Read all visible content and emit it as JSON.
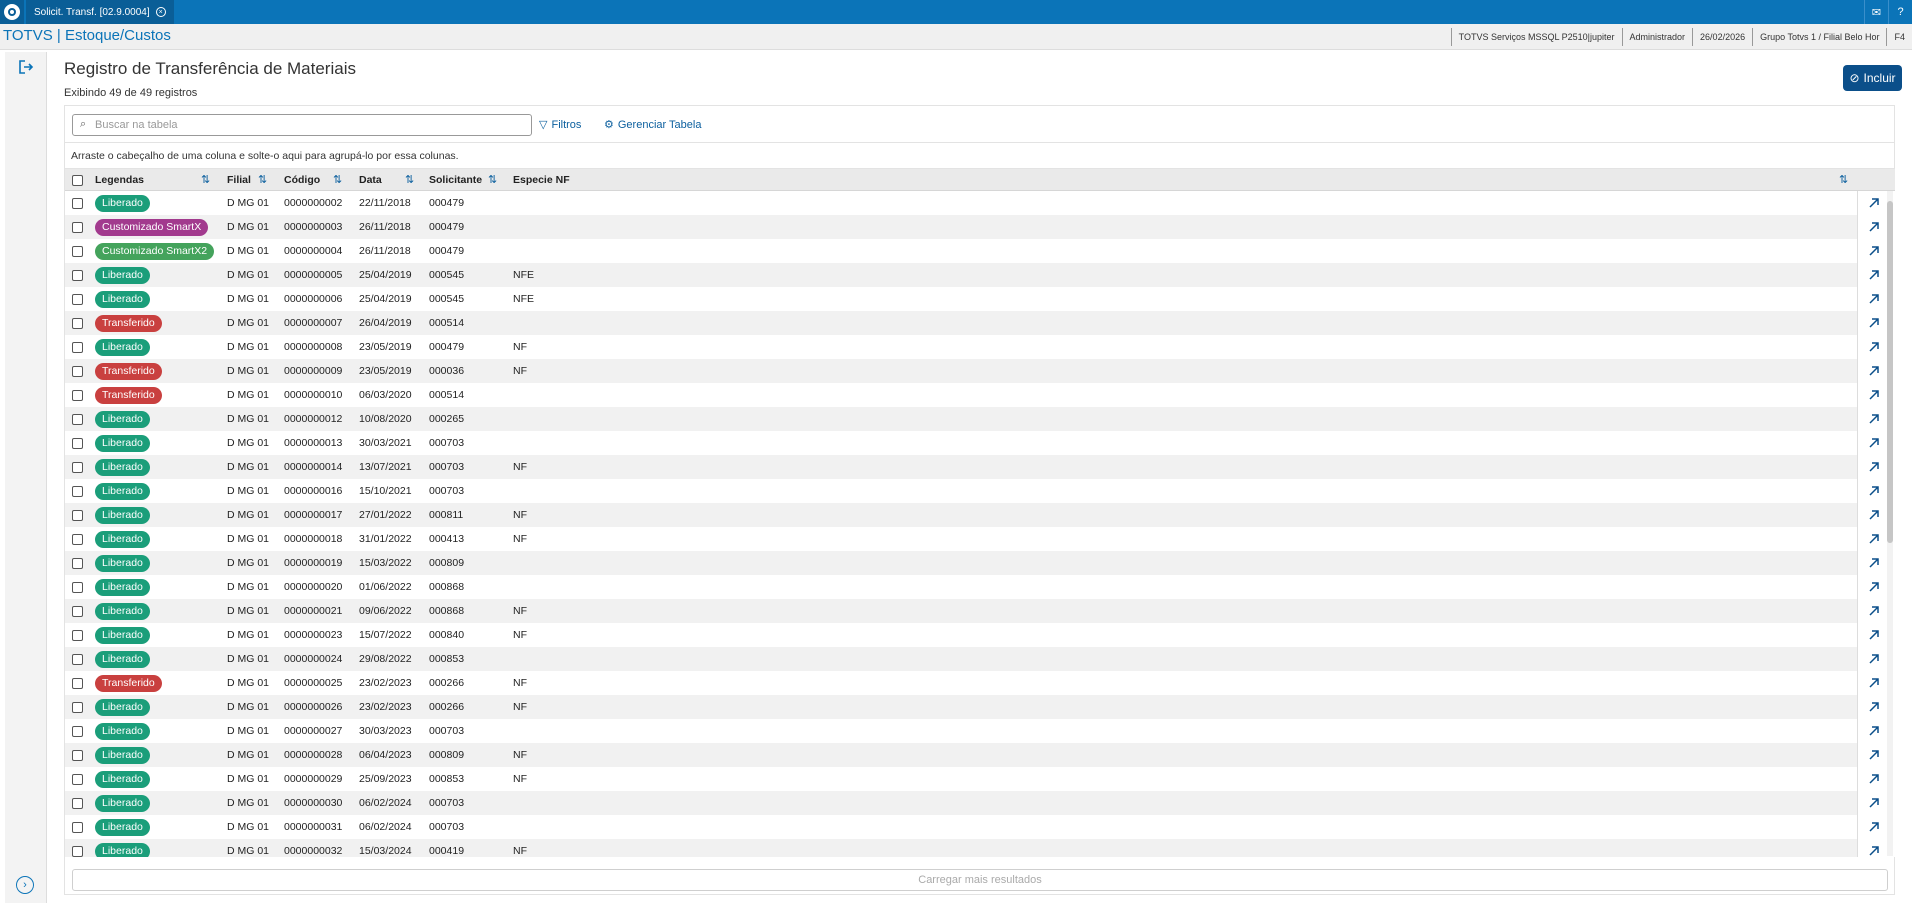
{
  "window": {
    "tab_title": "Solicit. Transf. [02.9.0004]",
    "close_glyph": "×",
    "right_icons": [
      "mail-icon",
      "help-icon"
    ]
  },
  "infobar": {
    "brand": "TOTVS | Estoque/Custos",
    "items": [
      "TOTVS Serviços MSSQL P2510|jupiter",
      "Administrador",
      "26/02/2026",
      "Grupo Totvs 1 / Filial Belo Hor",
      "F4"
    ]
  },
  "page": {
    "title": "Registro de Transferência de Materiais",
    "subtitle": "Exibindo 49 de 49 registros",
    "include_label": "Incluir"
  },
  "toolbar": {
    "search_placeholder": "Buscar na tabela",
    "filters_label": "Filtros",
    "manage_label": "Gerenciar Tabela"
  },
  "group_hint": "Arraste o cabeçalho de uma coluna e solte-o aqui para agrupá-lo por essa colunas.",
  "columns": {
    "legendas": "Legendas",
    "filial": "Filial",
    "codigo": "Código",
    "data": "Data",
    "solicitante": "Solicitante",
    "especie": "Especie NF"
  },
  "legend_colors": {
    "Liberado": "#1b9e7a",
    "Transferido": "#c9403f",
    "Customizado SmartX": "#a23a8e",
    "Customizado SmartX2": "#44a35c"
  },
  "rows": [
    {
      "legenda": "Liberado",
      "filial": "D MG 01",
      "codigo": "0000000002",
      "data": "22/11/2018",
      "solicitante": "000479",
      "especie": ""
    },
    {
      "legenda": "Customizado SmartX",
      "filial": "D MG 01",
      "codigo": "0000000003",
      "data": "26/11/2018",
      "solicitante": "000479",
      "especie": ""
    },
    {
      "legenda": "Customizado SmartX2",
      "filial": "D MG 01",
      "codigo": "0000000004",
      "data": "26/11/2018",
      "solicitante": "000479",
      "especie": ""
    },
    {
      "legenda": "Liberado",
      "filial": "D MG 01",
      "codigo": "0000000005",
      "data": "25/04/2019",
      "solicitante": "000545",
      "especie": "NFE"
    },
    {
      "legenda": "Liberado",
      "filial": "D MG 01",
      "codigo": "0000000006",
      "data": "25/04/2019",
      "solicitante": "000545",
      "especie": "NFE"
    },
    {
      "legenda": "Transferido",
      "filial": "D MG 01",
      "codigo": "0000000007",
      "data": "26/04/2019",
      "solicitante": "000514",
      "especie": ""
    },
    {
      "legenda": "Liberado",
      "filial": "D MG 01",
      "codigo": "0000000008",
      "data": "23/05/2019",
      "solicitante": "000479",
      "especie": "NF"
    },
    {
      "legenda": "Transferido",
      "filial": "D MG 01",
      "codigo": "0000000009",
      "data": "23/05/2019",
      "solicitante": "000036",
      "especie": "NF"
    },
    {
      "legenda": "Transferido",
      "filial": "D MG 01",
      "codigo": "0000000010",
      "data": "06/03/2020",
      "solicitante": "000514",
      "especie": ""
    },
    {
      "legenda": "Liberado",
      "filial": "D MG 01",
      "codigo": "0000000012",
      "data": "10/08/2020",
      "solicitante": "000265",
      "especie": ""
    },
    {
      "legenda": "Liberado",
      "filial": "D MG 01",
      "codigo": "0000000013",
      "data": "30/03/2021",
      "solicitante": "000703",
      "especie": ""
    },
    {
      "legenda": "Liberado",
      "filial": "D MG 01",
      "codigo": "0000000014",
      "data": "13/07/2021",
      "solicitante": "000703",
      "especie": "NF"
    },
    {
      "legenda": "Liberado",
      "filial": "D MG 01",
      "codigo": "0000000016",
      "data": "15/10/2021",
      "solicitante": "000703",
      "especie": ""
    },
    {
      "legenda": "Liberado",
      "filial": "D MG 01",
      "codigo": "0000000017",
      "data": "27/01/2022",
      "solicitante": "000811",
      "especie": "NF"
    },
    {
      "legenda": "Liberado",
      "filial": "D MG 01",
      "codigo": "0000000018",
      "data": "31/01/2022",
      "solicitante": "000413",
      "especie": "NF"
    },
    {
      "legenda": "Liberado",
      "filial": "D MG 01",
      "codigo": "0000000019",
      "data": "15/03/2022",
      "solicitante": "000809",
      "especie": ""
    },
    {
      "legenda": "Liberado",
      "filial": "D MG 01",
      "codigo": "0000000020",
      "data": "01/06/2022",
      "solicitante": "000868",
      "especie": ""
    },
    {
      "legenda": "Liberado",
      "filial": "D MG 01",
      "codigo": "0000000021",
      "data": "09/06/2022",
      "solicitante": "000868",
      "especie": "NF"
    },
    {
      "legenda": "Liberado",
      "filial": "D MG 01",
      "codigo": "0000000023",
      "data": "15/07/2022",
      "solicitante": "000840",
      "especie": "NF"
    },
    {
      "legenda": "Liberado",
      "filial": "D MG 01",
      "codigo": "0000000024",
      "data": "29/08/2022",
      "solicitante": "000853",
      "especie": ""
    },
    {
      "legenda": "Transferido",
      "filial": "D MG 01",
      "codigo": "0000000025",
      "data": "23/02/2023",
      "solicitante": "000266",
      "especie": "NF"
    },
    {
      "legenda": "Liberado",
      "filial": "D MG 01",
      "codigo": "0000000026",
      "data": "23/02/2023",
      "solicitante": "000266",
      "especie": "NF"
    },
    {
      "legenda": "Liberado",
      "filial": "D MG 01",
      "codigo": "0000000027",
      "data": "30/03/2023",
      "solicitante": "000703",
      "especie": ""
    },
    {
      "legenda": "Liberado",
      "filial": "D MG 01",
      "codigo": "0000000028",
      "data": "06/04/2023",
      "solicitante": "000809",
      "especie": "NF"
    },
    {
      "legenda": "Liberado",
      "filial": "D MG 01",
      "codigo": "0000000029",
      "data": "25/09/2023",
      "solicitante": "000853",
      "especie": "NF"
    },
    {
      "legenda": "Liberado",
      "filial": "D MG 01",
      "codigo": "0000000030",
      "data": "06/02/2024",
      "solicitante": "000703",
      "especie": ""
    },
    {
      "legenda": "Liberado",
      "filial": "D MG 01",
      "codigo": "0000000031",
      "data": "06/02/2024",
      "solicitante": "000703",
      "especie": ""
    },
    {
      "legenda": "Liberado",
      "filial": "D MG 01",
      "codigo": "0000000032",
      "data": "15/03/2024",
      "solicitante": "000419",
      "especie": "NF"
    }
  ],
  "load_more_label": "Carregar mais resultados"
}
